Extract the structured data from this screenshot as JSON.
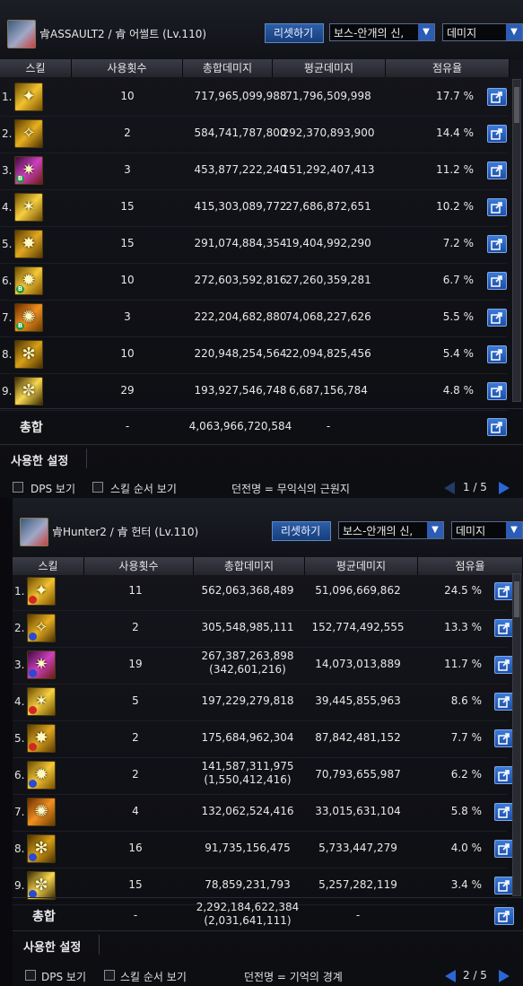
{
  "panels": [
    {
      "character": "肻ASSAULT2 / 肻 어썰트 (Lv.110)",
      "reset_label": "리셋하기",
      "boss_dropdown": "보스-안개의 신,",
      "metric_dropdown": "데미지",
      "headers": {
        "skill": "스킬",
        "uses": "사용횟수",
        "total": "총합데미지",
        "avg": "평균데미지",
        "share": "점유율"
      },
      "rows": [
        {
          "rank": "1.",
          "uses": "10",
          "total": "717,965,099,988",
          "total2": "",
          "avg": "71,796,509,998",
          "share": "17.7 %"
        },
        {
          "rank": "2.",
          "uses": "2",
          "total": "584,741,787,800",
          "total2": "",
          "avg": "292,370,893,900",
          "share": "14.4 %"
        },
        {
          "rank": "3.",
          "uses": "3",
          "total": "453,877,222,240",
          "total2": "",
          "avg": "151,292,407,413",
          "share": "11.2 %"
        },
        {
          "rank": "4.",
          "uses": "15",
          "total": "415,303,089,772",
          "total2": "",
          "avg": "27,686,872,651",
          "share": "10.2 %"
        },
        {
          "rank": "5.",
          "uses": "15",
          "total": "291,074,884,354",
          "total2": "",
          "avg": "19,404,992,290",
          "share": "7.2 %"
        },
        {
          "rank": "6.",
          "uses": "10",
          "total": "272,603,592,816",
          "total2": "",
          "avg": "27,260,359,281",
          "share": "6.7 %"
        },
        {
          "rank": "7.",
          "uses": "3",
          "total": "222,204,682,880",
          "total2": "",
          "avg": "74,068,227,626",
          "share": "5.5 %"
        },
        {
          "rank": "8.",
          "uses": "10",
          "total": "220,948,254,564",
          "total2": "",
          "avg": "22,094,825,456",
          "share": "5.4 %"
        },
        {
          "rank": "9.",
          "uses": "29",
          "total": "193,927,546,748",
          "total2": "",
          "avg": "6,687,156,784",
          "share": "4.8 %"
        }
      ],
      "total": {
        "label": "총합",
        "uses": "-",
        "total": "4,063,966,720,584",
        "total2": "",
        "avg": "-"
      },
      "settings_label": "사용한 설정",
      "dps_label": "DPS 보기",
      "order_label": "스킬 순서 보기",
      "dungeon": "던전명 = 무익식의 근원지",
      "page": "1 / 5"
    },
    {
      "character": "肻Hunter2 / 肻 헌터 (Lv.110)",
      "reset_label": "리셋하기",
      "boss_dropdown": "보스-안개의 신,",
      "metric_dropdown": "데미지",
      "headers": {
        "skill": "스킬",
        "uses": "사용횟수",
        "total": "총합데미지",
        "avg": "평균데미지",
        "share": "점유율"
      },
      "rows": [
        {
          "rank": "1.",
          "uses": "11",
          "total": "562,063,368,489",
          "total2": "",
          "avg": "51,096,669,862",
          "share": "24.5 %"
        },
        {
          "rank": "2.",
          "uses": "2",
          "total": "305,548,985,111",
          "total2": "",
          "avg": "152,774,492,555",
          "share": "13.3 %"
        },
        {
          "rank": "3.",
          "uses": "19",
          "total": "267,387,263,898",
          "total2": "(342,601,216)",
          "avg": "14,073,013,889",
          "share": "11.7 %"
        },
        {
          "rank": "4.",
          "uses": "5",
          "total": "197,229,279,818",
          "total2": "",
          "avg": "39,445,855,963",
          "share": "8.6 %"
        },
        {
          "rank": "5.",
          "uses": "2",
          "total": "175,684,962,304",
          "total2": "",
          "avg": "87,842,481,152",
          "share": "7.7 %"
        },
        {
          "rank": "6.",
          "uses": "2",
          "total": "141,587,311,975",
          "total2": "(1,550,412,416)",
          "avg": "70,793,655,987",
          "share": "6.2 %"
        },
        {
          "rank": "7.",
          "uses": "4",
          "total": "132,062,524,416",
          "total2": "",
          "avg": "33,015,631,104",
          "share": "5.8 %"
        },
        {
          "rank": "8.",
          "uses": "16",
          "total": "91,735,156,475",
          "total2": "",
          "avg": "5,733,447,279",
          "share": "4.0 %"
        },
        {
          "rank": "9.",
          "uses": "15",
          "total": "78,859,231,793",
          "total2": "",
          "avg": "5,257,282,119",
          "share": "3.4 %"
        }
      ],
      "total": {
        "label": "총합",
        "uses": "-",
        "total": "2,292,184,622,384",
        "total2": "(2,031,641,111)",
        "avg": "-"
      },
      "settings_label": "사용한 설정",
      "dps_label": "DPS 보기",
      "order_label": "스킬 순서 보기",
      "dungeon": "던전명 = 기억의 경계",
      "page": "2 / 5"
    }
  ],
  "icons": {
    "skill_icons": [
      "skill-icon"
    ],
    "row_action": "share-icon",
    "dropdown": "chevron-down-icon",
    "pager_prev": "arrow-left-icon",
    "pager_next": "arrow-right-icon"
  },
  "colors": {
    "accent": "#2b5db5",
    "icon_gold": "#c89a20",
    "badge_green": "#1f9a3a",
    "badge_red": "#d02828",
    "badge_blue": "#2a4ad0"
  }
}
